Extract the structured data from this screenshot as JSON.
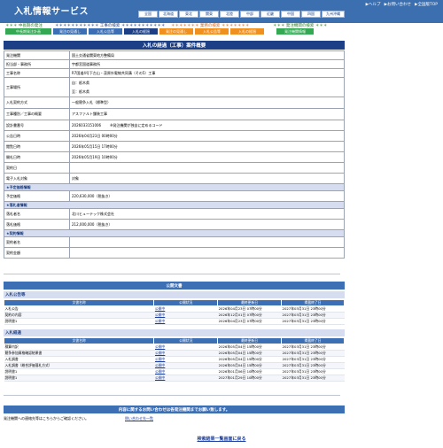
{
  "header": {
    "title": "入札情報サービス",
    "util_links": [
      "▶ヘルプ",
      "▶お問い合わせ",
      "▶全国版TOP"
    ],
    "regions": [
      "全国",
      "北海道",
      "東北",
      "関東",
      "北陸",
      "中部",
      "近畿",
      "中国",
      "四国",
      "九州沖縄"
    ]
  },
  "categories": [
    {
      "label": "＊＊＊ 中長期の発注",
      "color": "#2c7d2c"
    },
    {
      "label": "＊＊＊＊＊＊＊＊＊＊＊ 工事の検索 ＊＊＊＊＊＊＊＊＊＊＊",
      "color": "#1c3f85"
    },
    {
      "label": "＊＊＊＊＊＊＊ 業務の検索 ＊＊＊＊＊＊＊",
      "color": "#d2691e"
    },
    {
      "label": "＊＊＊ 発注機関の検索 ＊＊＊",
      "color": "#2c7d2c"
    }
  ],
  "tabs": [
    {
      "label": "中長期発注計画",
      "color": "#34a853"
    },
    {
      "label": "発注の見通し",
      "color": "#3d6fb4"
    },
    {
      "label": "入札公告等",
      "color": "#3d6fb4"
    },
    {
      "label": "入札の経過",
      "color": "#1c3f85"
    },
    {
      "label": "発注の見通し",
      "color": "#f0901e"
    },
    {
      "label": "入札公告等",
      "color": "#f0901e"
    },
    {
      "label": "入札の経過",
      "color": "#f0901e"
    },
    {
      "label": "発注機関情報",
      "color": "#34a853"
    }
  ],
  "page_title": "入札の経過（工事）案件概要",
  "info_rows": [
    {
      "key": "発注機関",
      "value": "国土交通省関東地方整備局"
    },
    {
      "key": "担当部・事務所",
      "value": "宇都宮国道事務所"
    },
    {
      "key": "工事名称",
      "value": "R7国道4号下古山・茂原外電線共同溝（その5）工事"
    },
    {
      "key": "工事場所",
      "value": "自：栃木県",
      "value2": "至：栃木県"
    },
    {
      "key": "入札契約方式",
      "value": "一般競争入札（標準型）"
    },
    {
      "key": "工事種別／工事の概要",
      "value": "アスファルト舗装工事"
    },
    {
      "key": "設計書番号",
      "value": "2026033151006",
      "note": "※発注機関が独自に定めるコード"
    },
    {
      "key": "公告日時",
      "value": "2026年04月23日 00時00分"
    },
    {
      "key": "閲覧日時",
      "value": "2026年05月15日 17時00分"
    },
    {
      "key": "開札日時",
      "value": "2026年05月19日 10時00分"
    },
    {
      "key": "契約日",
      "value": ""
    },
    {
      "key": "電子入札対象",
      "value": "対象"
    }
  ],
  "sections": {
    "estimate": "★予定価格情報",
    "estimate_rows": [
      {
        "key": "予定価格",
        "value": "220,630,000（税抜き）"
      }
    ],
    "winner": "★落札者情報",
    "winner_rows": [
      {
        "key": "落札者名",
        "value": "北川ヒューテック株式会社"
      },
      {
        "key": "落札価格",
        "value": "212,000,000（税抜き）"
      }
    ],
    "contract": "★契約情報",
    "contract_rows": [
      {
        "key": "契約者名",
        "value": ""
      },
      {
        "key": "契約金額",
        "value": ""
      }
    ]
  },
  "public_docs": {
    "title": "公開文書",
    "headers": [
      "文書名称",
      "公開状況",
      "最終更新日",
      "掲載終了日"
    ],
    "group1_title": "入札公告等",
    "group1": [
      {
        "name": "入札公告",
        "status": "公開中",
        "updated": "2026年04月23日 07時00分",
        "end": "2027年03月31日 23時00分"
      },
      {
        "name": "契約の内容",
        "status": "公開中",
        "updated": "2026年12月01日 07時00分",
        "end": "2027年03月31日 23時00分"
      },
      {
        "name": "説明書1",
        "status": "公開中",
        "updated": "2026年04月23日 07時00分",
        "end": "2027年03月31日 23時00分"
      }
    ],
    "group2_title": "入札経過",
    "group2": [
      {
        "name": "積算内訳",
        "status": "公開中",
        "updated": "2026年05月04日 15時00分",
        "end": "2027年03月31日 23時00分"
      },
      {
        "name": "競争参加資格確認結果書",
        "status": "公開中",
        "updated": "2026年05月04日 15時00分",
        "end": "2027年03月31日 23時00分"
      },
      {
        "name": "入札調書",
        "status": "公開中",
        "updated": "2026年05月04日 15時00分",
        "end": "2027年03月31日 23時00分"
      },
      {
        "name": "入札調書（総合評価落札方式）",
        "status": "公開中",
        "updated": "2026年05月04日 15時00分",
        "end": "2027年03月31日 23時00分"
      },
      {
        "name": "説明書1",
        "status": "公開中",
        "updated": "2026年01月06日 10時00分",
        "end": "2027年03月31日 23時00分"
      },
      {
        "name": "説明書1",
        "status": "公開中",
        "updated": "2027年01月29日 10時00分",
        "end": "2027年03月31日 23時00分"
      }
    ]
  },
  "contact": {
    "bar": "内容に関するお問い合わせは各発注機関までお願い致します。",
    "text": "発注機関への連絡先等はこちらからご確認ください。",
    "link": "問い合わせ先一覧"
  },
  "back_link": "検索結果一覧画面に戻る"
}
